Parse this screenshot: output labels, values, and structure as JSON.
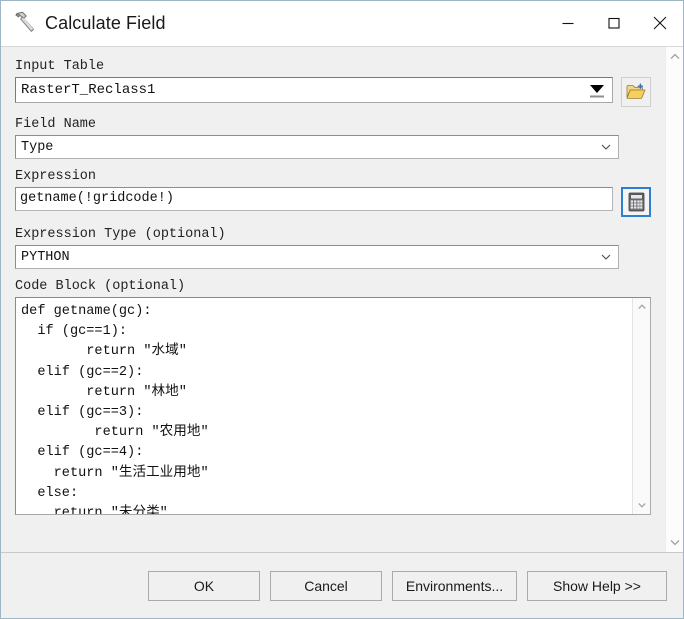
{
  "window": {
    "title": "Calculate Field",
    "icon": "hammer-tool-icon",
    "controls": {
      "minimize": "minimize-icon",
      "maximize": "maximize-icon",
      "close": "close-icon"
    }
  },
  "form": {
    "input_table": {
      "label": "Input Table",
      "value": "RasterT_Reclass1",
      "browse_icon": "open-folder-icon",
      "caret_icon": "caret-down-filled-icon"
    },
    "field_name": {
      "label": "Field Name",
      "value": "Type",
      "caret_icon": "chevron-down-icon"
    },
    "expression": {
      "label": "Expression",
      "value": "getname(!gridcode!)",
      "calculator_icon": "calculator-icon"
    },
    "expression_type": {
      "label": "Expression Type (optional)",
      "value": "PYTHON",
      "caret_icon": "chevron-down-icon"
    },
    "code_block": {
      "label": "Code Block (optional)",
      "value": "def getname(gc):\n  if (gc==1):\n        return ″水域″\n  elif (gc==2):\n        return ″林地″\n  elif (gc==3):\n         return ″农用地″\n  elif (gc==4):\n    return ″生活工业用地″\n  else:\n    return ″未分类″"
    }
  },
  "scrollbars": {
    "main_up_icon": "chevron-up-icon",
    "main_down_icon": "chevron-down-icon",
    "code_up_icon": "chevron-up-icon",
    "code_down_icon": "chevron-down-icon"
  },
  "footer": {
    "ok": "OK",
    "cancel": "Cancel",
    "environments": "Environments...",
    "show_help": "Show Help >>"
  },
  "colors": {
    "window_border": "#9fb6c4",
    "dialog_bg": "#f0f0f0",
    "focus_blue": "#2f7fd1",
    "folder_yellow": "#e9c45a"
  }
}
